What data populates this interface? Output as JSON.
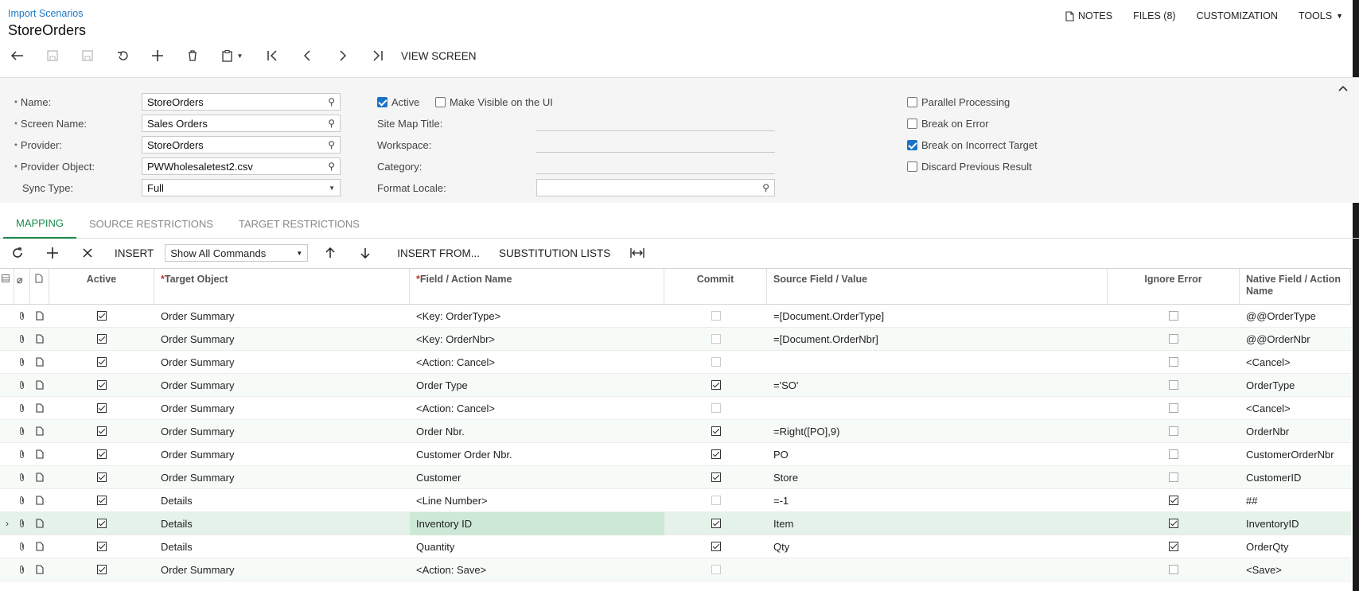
{
  "header": {
    "breadcrumb": "Import Scenarios",
    "title": "StoreOrders",
    "links": {
      "notes": "NOTES",
      "files": "FILES (8)",
      "customization": "CUSTOMIZATION",
      "tools": "TOOLS"
    }
  },
  "toolbar": {
    "view_screen": "VIEW SCREEN"
  },
  "form": {
    "name_label": "Name:",
    "name_value": "StoreOrders",
    "screen_label": "Screen Name:",
    "screen_value": "Sales Orders",
    "provider_label": "Provider:",
    "provider_value": "StoreOrders",
    "provider_object_label": "Provider Object:",
    "provider_object_value": "PWWholesaletest2.csv",
    "sync_label": "Sync Type:",
    "sync_value": "Full",
    "active_label": "Active",
    "visible_label": "Make Visible on the UI",
    "sitemap_label": "Site Map Title:",
    "workspace_label": "Workspace:",
    "category_label": "Category:",
    "locale_label": "Format Locale:",
    "parallel_label": "Parallel Processing",
    "break_error_label": "Break on Error",
    "break_target_label": "Break on Incorrect Target",
    "discard_label": "Discard Previous Result"
  },
  "tabs": [
    "MAPPING",
    "SOURCE RESTRICTIONS",
    "TARGET RESTRICTIONS"
  ],
  "gridbar": {
    "insert": "INSERT",
    "filter": "Show All Commands",
    "insert_from": "INSERT FROM...",
    "subst": "SUBSTITUTION LISTS"
  },
  "grid": {
    "headers": {
      "active": "Active",
      "target": "Target Object",
      "field": "Field / Action Name",
      "commit": "Commit",
      "source": "Source Field / Value",
      "ignore": "Ignore Error",
      "native": "Native Field / Action Name"
    },
    "rows": [
      {
        "target": "Order Summary",
        "field": "<Key: OrderType>",
        "source": "=[Document.OrderType]",
        "native": "@@OrderType"
      },
      {
        "target": "Order Summary",
        "field": "<Key: OrderNbr>",
        "source": "=[Document.OrderNbr]",
        "native": "@@OrderNbr"
      },
      {
        "target": "Order Summary",
        "field": "<Action: Cancel>",
        "source": "",
        "native": "<Cancel>"
      },
      {
        "target": "Order Summary",
        "field": "Order Type",
        "source": "='SO'",
        "native": "OrderType"
      },
      {
        "target": "Order Summary",
        "field": "<Action: Cancel>",
        "source": "",
        "native": "<Cancel>"
      },
      {
        "target": "Order Summary",
        "field": "Order Nbr.",
        "source": "=Right([PO],9)",
        "native": "OrderNbr"
      },
      {
        "target": "Order Summary",
        "field": "Customer Order Nbr.",
        "source": "PO",
        "native": "CustomerOrderNbr"
      },
      {
        "target": "Order Summary",
        "field": "Customer",
        "source": "Store",
        "native": "CustomerID"
      },
      {
        "target": "Details",
        "field": "<Line Number>",
        "source": "=-1",
        "native": "##"
      },
      {
        "target": "Details",
        "field": "Inventory ID",
        "source": "Item",
        "native": "InventoryID"
      },
      {
        "target": "Details",
        "field": "Quantity",
        "source": "Qty",
        "native": "OrderQty"
      },
      {
        "target": "Order Summary",
        "field": "<Action: Save>",
        "source": "",
        "native": "<Save>"
      }
    ]
  }
}
